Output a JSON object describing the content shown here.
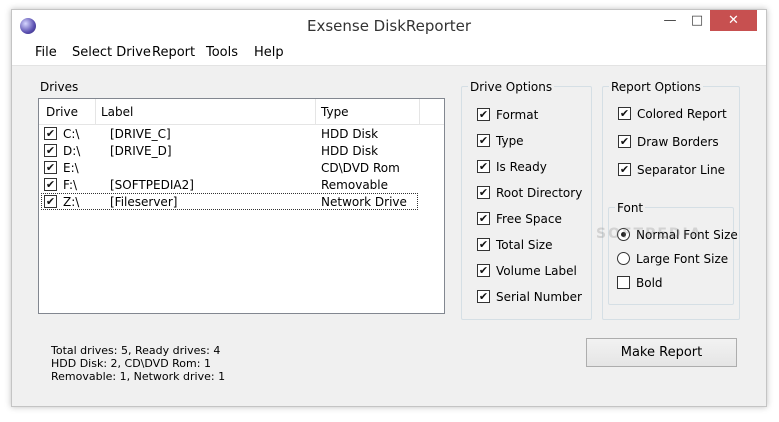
{
  "window": {
    "title": "Exsense DiskReporter",
    "minimize": "—",
    "maximize": "□",
    "close": "✕"
  },
  "menu": {
    "file": "File",
    "select_drive": "Select Drive",
    "report": "Report",
    "tools": "Tools",
    "help": "Help"
  },
  "drives": {
    "group_title": "Drives",
    "columns": {
      "drive": "Drive",
      "label": "Label",
      "type": "Type"
    },
    "rows": [
      {
        "checked": true,
        "drive": "C:\\",
        "label": "[DRIVE_C]",
        "type": "HDD Disk"
      },
      {
        "checked": true,
        "drive": "D:\\",
        "label": "[DRIVE_D]",
        "type": "HDD Disk"
      },
      {
        "checked": true,
        "drive": "E:\\",
        "label": "",
        "type": "CD\\DVD Rom"
      },
      {
        "checked": true,
        "drive": "F:\\",
        "label": "[SOFTPEDIA2]",
        "type": "Removable"
      },
      {
        "checked": true,
        "drive": "Z:\\",
        "label": "[Fileserver]",
        "type": "Network Drive"
      }
    ]
  },
  "drive_options": {
    "group_title": "Drive Options",
    "items": [
      {
        "label": "Format",
        "checked": true
      },
      {
        "label": "Type",
        "checked": true
      },
      {
        "label": "Is Ready",
        "checked": true
      },
      {
        "label": "Root Directory",
        "checked": true
      },
      {
        "label": "Free Space",
        "checked": true
      },
      {
        "label": "Total Size",
        "checked": true
      },
      {
        "label": "Volume Label",
        "checked": true
      },
      {
        "label": "Serial Number",
        "checked": true
      }
    ]
  },
  "report_options": {
    "group_title": "Report Options",
    "items": [
      {
        "label": "Colored Report",
        "checked": true
      },
      {
        "label": "Draw Borders",
        "checked": true
      },
      {
        "label": "Separator Line",
        "checked": true
      }
    ],
    "font": {
      "group_title": "Font",
      "normal": {
        "label": "Normal Font Size",
        "selected": true
      },
      "large": {
        "label": "Large Font Size",
        "selected": false
      },
      "bold": {
        "label": "Bold",
        "checked": false
      }
    }
  },
  "status": {
    "line1": "Total drives: 5, Ready drives: 4",
    "line2": "HDD Disk: 2, CD\\DVD Rom: 1",
    "line3": "Removable: 1, Network drive: 1"
  },
  "actions": {
    "make_report": "Make Report"
  },
  "watermark": "SOFTPEDIA",
  "check_glyph": "✔"
}
